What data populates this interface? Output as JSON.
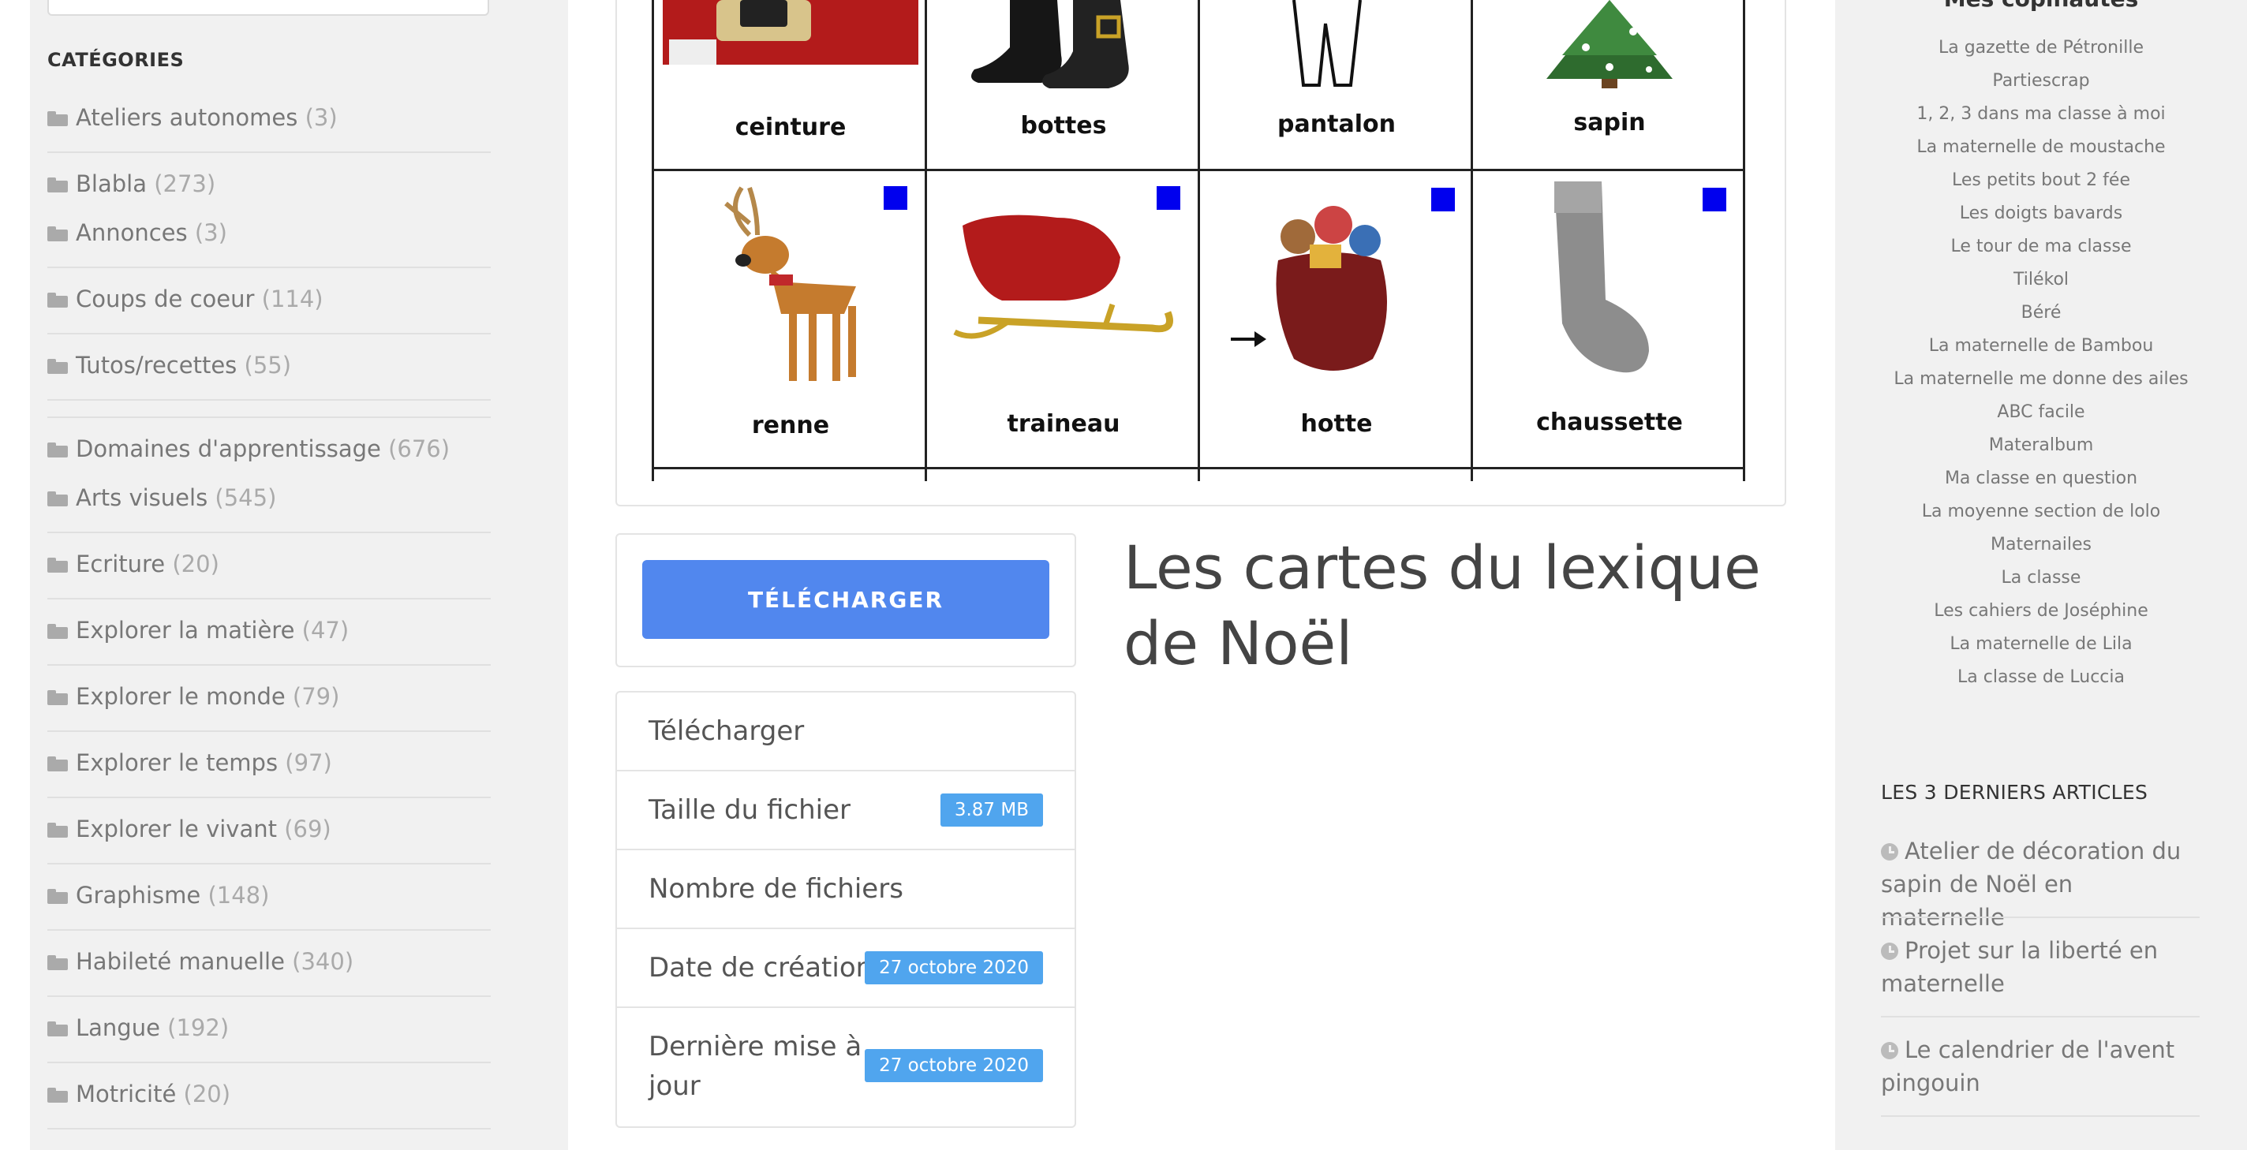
{
  "sidebar": {
    "categories_title": "CATÉGORIES",
    "categories": [
      {
        "name": "Ateliers autonomes",
        "count": "(3)"
      },
      {
        "name": "Blabla",
        "count": "(273)"
      },
      {
        "name": "Annonces",
        "count": "(3)"
      },
      {
        "name": "Coups de coeur",
        "count": "(114)"
      },
      {
        "name": "Tutos/recettes",
        "count": "(55)"
      },
      {
        "name": "Domaines d'apprentissage",
        "count": "(676)"
      },
      {
        "name": "Arts visuels",
        "count": "(545)"
      },
      {
        "name": "Ecriture",
        "count": "(20)"
      },
      {
        "name": "Explorer la matière",
        "count": "(47)"
      },
      {
        "name": "Explorer le monde",
        "count": "(79)"
      },
      {
        "name": "Explorer le temps",
        "count": "(97)"
      },
      {
        "name": "Explorer le vivant",
        "count": "(69)"
      },
      {
        "name": "Graphisme",
        "count": "(148)"
      },
      {
        "name": "Habileté manuelle",
        "count": "(340)"
      },
      {
        "name": "Langue",
        "count": "(192)"
      },
      {
        "name": "Motricité",
        "count": "(20)"
      }
    ]
  },
  "preview": {
    "row1_labels": [
      "ceinture",
      "bottes",
      "pantalon",
      "sapin"
    ],
    "row2_labels": [
      "renne",
      "traineau",
      "hotte",
      "chaussette"
    ]
  },
  "download": {
    "button_label": "TÉLÉCHARGER"
  },
  "info": {
    "header": "Télécharger",
    "file_size_label": "Taille du fichier",
    "file_size_value": "3.87 MB",
    "file_count_label": "Nombre de fichiers",
    "created_label": "Date de création",
    "created_value": "27 octobre 2020",
    "updated_label": "Dernière mise à jour",
    "updated_value": "27 octobre 2020"
  },
  "page": {
    "title": "Les cartes du lexique de Noël"
  },
  "right_sidebar": {
    "blogroll_title": "Mes copinautes",
    "blogroll": [
      "La gazette de Pétronille",
      "Partiescrap",
      "1, 2, 3 dans ma classe à moi",
      "La maternelle de moustache",
      "Les petits bout 2 fée",
      "Les doigts bavards",
      "Le tour de ma classe",
      "Tilékol",
      "Béré",
      "La maternelle de Bambou",
      "La maternelle me donne des ailes",
      "ABC facile",
      "Materalbum",
      "Ma classe en question",
      "La moyenne section de lolo",
      "Maternailes",
      "La classe",
      "Les cahiers de Joséphine",
      "La maternelle de Lila",
      "La classe de Luccia"
    ],
    "recent_title": "LES 3 DERNIERS ARTICLES",
    "recent": [
      "Atelier de décoration du sapin de Noël en maternelle",
      "Projet sur la liberté en maternelle",
      "Le calendrier de l'avent pingouin"
    ]
  },
  "colors": {
    "button": "#5187ee",
    "badge": "#50a5ee",
    "sidebar_bg": "#f1f1f1"
  }
}
